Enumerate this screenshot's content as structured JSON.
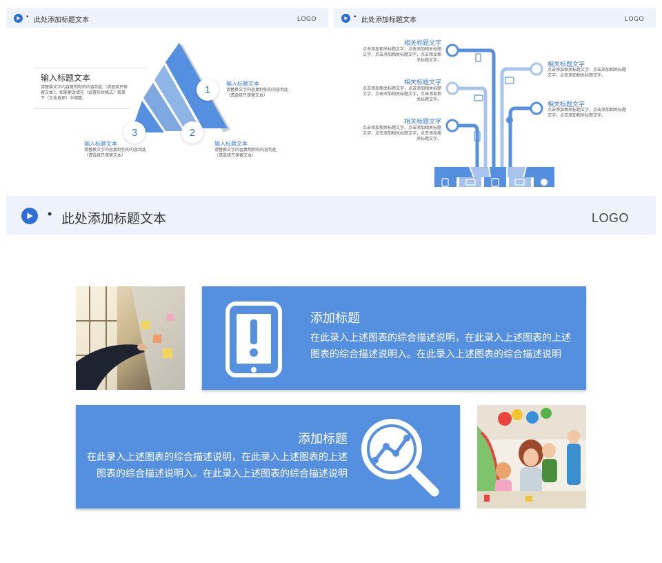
{
  "slide1": {
    "header": {
      "title": "此处添加标题文本",
      "logo": "LOGO"
    },
    "left_block": {
      "title": "输入标题文本",
      "text": "请替换文字内容复制你的内容到此（请选择只保留文本）。如需更改请在（设置形状格式）菜单下（文本选项）中调整。"
    },
    "items": [
      {
        "number": "1",
        "title": "输入标题文本",
        "text": "请替换文字内容复制你的内容到此（请选择只保留文本）"
      },
      {
        "number": "2",
        "title": "输入标题文本",
        "text": "请替换文字内容复制你的内容到此（请选择只保留文本）"
      },
      {
        "number": "3",
        "title": "输入标题文本",
        "text": "请替换文字内容复制你的内容到此（请选择只保留文本）"
      }
    ]
  },
  "slide2": {
    "header": {
      "title": "此处添加标题文本",
      "logo": "LOGO"
    },
    "left_items": [
      {
        "title": "相关标题文字",
        "text": "点击添加相关标题文字，点击添加相关标题文字，点击添加相关标题文字，点击添加相关标题文字。"
      },
      {
        "title": "相关标题文字",
        "text": "点击添加相关标题文字，点击添加相关标题文字，点击添加相关标题文字，点击添加相关标题文字。"
      },
      {
        "title": "相关标题文字",
        "text": "点击添加相关标题文字，点击添加相关标题文字，点击添加相关标题文字，点击添加相关标题文字。"
      }
    ],
    "right_items": [
      {
        "title": "相关标题文字",
        "text": "点击添加相关标题文字，点击添加相关标题文字，点击添加相关标题文字。"
      },
      {
        "title": "相关标题文字",
        "text": "点击添加相关标题文字，点击添加相关标题文字，点击添加相关标题文字。"
      }
    ]
  },
  "slide3": {
    "header": {
      "title": "此处添加标题文本",
      "logo": "LOGO"
    },
    "card1": {
      "title": "添加标题",
      "text": "在此录入上述图表的综合描述说明，在此录入上述图表的上述图表的综合描述说明入。在此录入上述图表的综合描述说明",
      "icon": "phone-alert-icon"
    },
    "card2": {
      "title": "添加标题",
      "text": "在此录入上述图表的综合描述说明，在此录入上述图表的上述图表的综合描述说明入。在此录入上述图表的综合描述说明",
      "icon": "magnifier-chart-icon"
    },
    "colors": {
      "accent": "#5590e0",
      "header_bg": "#eef2fa",
      "play": "#2c6fd6"
    }
  }
}
